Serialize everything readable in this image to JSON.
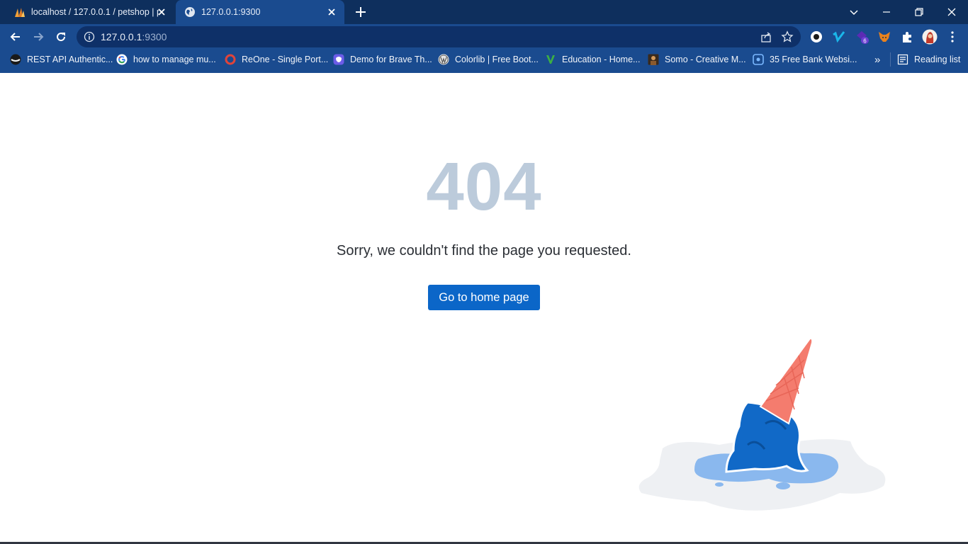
{
  "tabs": [
    {
      "title": "localhost / 127.0.0.1 / petshop | p",
      "active": false
    },
    {
      "title": "127.0.0.1:9300",
      "active": true
    }
  ],
  "address_bar": {
    "host": "127.0.0.1",
    "port": ":9300"
  },
  "bookmarks": [
    {
      "label": "REST API Authentic...",
      "icon": "dark-circle-icon"
    },
    {
      "label": "how to manage mu...",
      "icon": "google-icon"
    },
    {
      "label": "ReOne - Single Port...",
      "icon": "red-ring-icon"
    },
    {
      "label": "Demo for Brave Th...",
      "icon": "purple-app-icon"
    },
    {
      "label": "Colorlib | Free Boot...",
      "icon": "wordpress-icon"
    },
    {
      "label": "Education - Home...",
      "icon": "green-leaf-icon"
    },
    {
      "label": "Somo - Creative M...",
      "icon": "portrait-icon"
    },
    {
      "label": "35 Free Bank Websi...",
      "icon": "blue-square-icon"
    }
  ],
  "bookmarks_overflow": "»",
  "reading_list": "Reading list",
  "extension_badge": "6",
  "page": {
    "code": "404",
    "message": "Sorry, we couldn't find the page you requested.",
    "button": "Go to home page"
  },
  "colors": {
    "chrome": "#1a4b8f",
    "tabstrip": "#0e2f5d",
    "code": "#bccbdb",
    "button": "#0b66c8",
    "ice_cream": "#1169c7",
    "cone": "#f47c6e"
  }
}
